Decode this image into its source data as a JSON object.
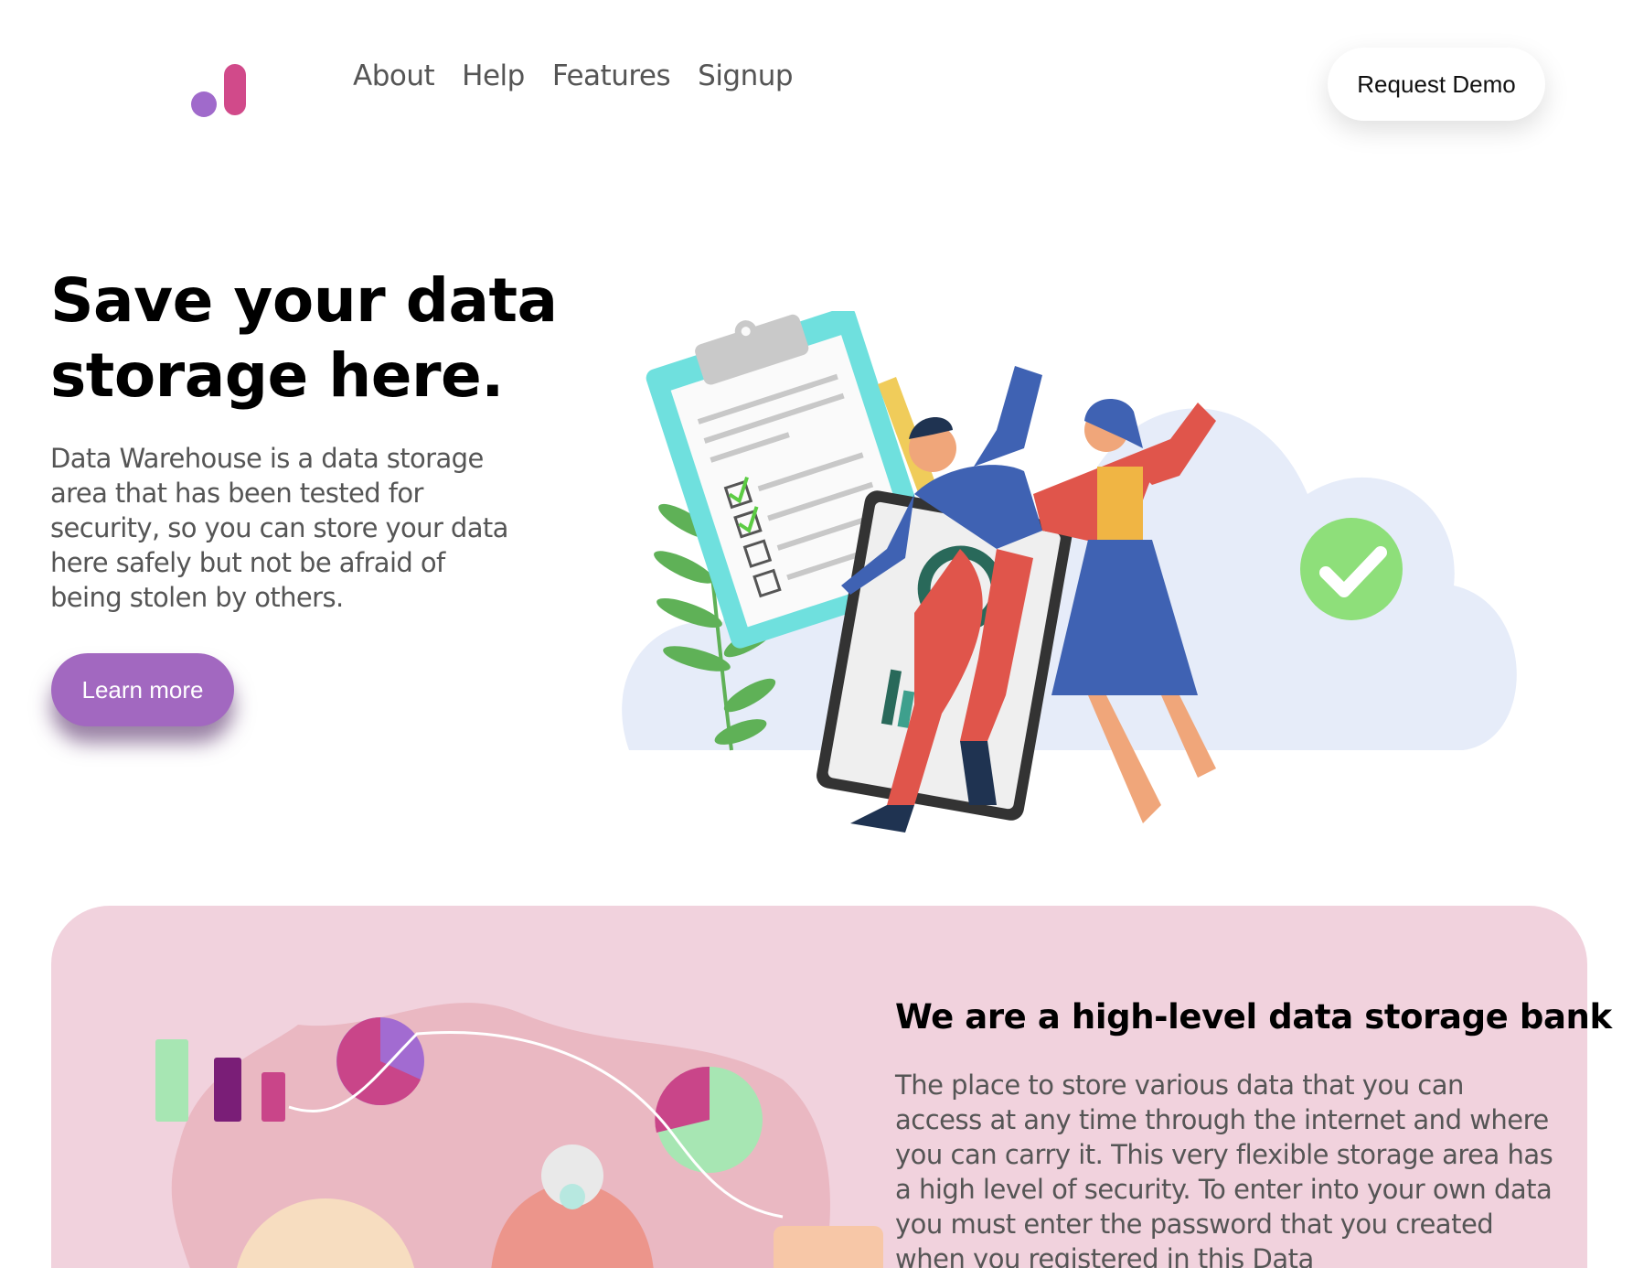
{
  "header": {
    "logo_icon": "bar-logo-icon",
    "nav": [
      {
        "label": "About"
      },
      {
        "label": "Help"
      },
      {
        "label": "Features"
      },
      {
        "label": "Signup"
      }
    ],
    "demo_label": "Request Demo"
  },
  "hero": {
    "title": "Save your data storage here.",
    "text": "Data Warehouse is a data storage area that has been tested for security, so you can store your data here safely but not be afraid of being stolen by others.",
    "button_label": "Learn more",
    "button_color": "#a268c0"
  },
  "section": {
    "background": "#f1d2dd",
    "title": "We are a high-level data storage bank",
    "text": "The place to store various data that you can access at any time through the internet and where you can carry it. This very flexible storage area has a high level of security. To enter into your own data you must enter the password that you created when you registered in this Data"
  },
  "colors": {
    "logo_dot": "#a06acb",
    "logo_bar": "#d14a8a"
  }
}
